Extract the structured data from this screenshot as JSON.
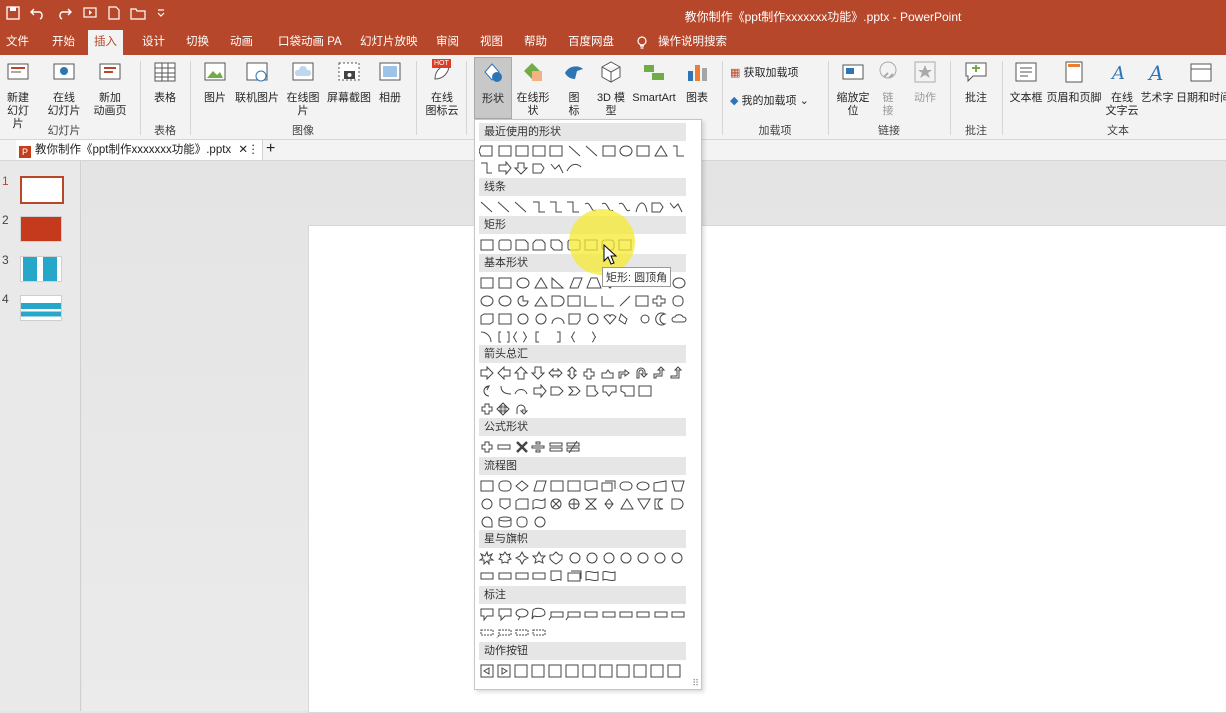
{
  "title": "教你制作《ppt制作xxxxxxx功能》.pptx  -  PowerPoint",
  "qat": [
    "save-icon",
    "undo-icon",
    "redo-icon",
    "start-icon",
    "new-icon",
    "open-icon",
    "customize-icon"
  ],
  "tabs": [
    "文件",
    "开始",
    "插入",
    "设计",
    "切换",
    "动画",
    "口袋动画 PA",
    "幻灯片放映",
    "审阅",
    "视图",
    "帮助",
    "百度网盘",
    "操作说明搜索"
  ],
  "active_tab": "插入",
  "ribbon": {
    "buttons": [
      "新建\n幻灯片",
      "在线\n幻灯片",
      "新加\n动画页",
      "表格",
      "图片",
      "联机图片",
      "在线图片",
      "屏幕截图",
      "相册",
      "在线\n图标云",
      "形状",
      "在线形状",
      "图\n标",
      "3D 模\n型",
      "SmartArt",
      "图表",
      "获取加载项",
      "我的加载项",
      "缩放定\n位",
      "链\n接",
      "动作",
      "批注",
      "文本框",
      "页眉和页脚",
      "在线\n文字云",
      "艺术字",
      "日期和时间"
    ],
    "groups": [
      "幻灯片",
      "表格",
      "图像",
      "加载项",
      "链接",
      "批注",
      "文本"
    ],
    "hot_badge": "HOT"
  },
  "document_tab": "教你制作《ppt制作xxxxxxx功能》.pptx",
  "slide_numbers": [
    "1",
    "2",
    "3",
    "4"
  ],
  "gallery": {
    "sections": [
      "最近使用的形状",
      "线条",
      "矩形",
      "基本形状",
      "箭头总汇",
      "公式形状",
      "流程图",
      "星与旗帜",
      "标注",
      "动作按钮"
    ]
  },
  "tooltip": "矩形: 圆顶角",
  "colors": {
    "accent": "#b7472a",
    "ribbon": "#f3f3f3",
    "highlight": "#f5e632"
  }
}
